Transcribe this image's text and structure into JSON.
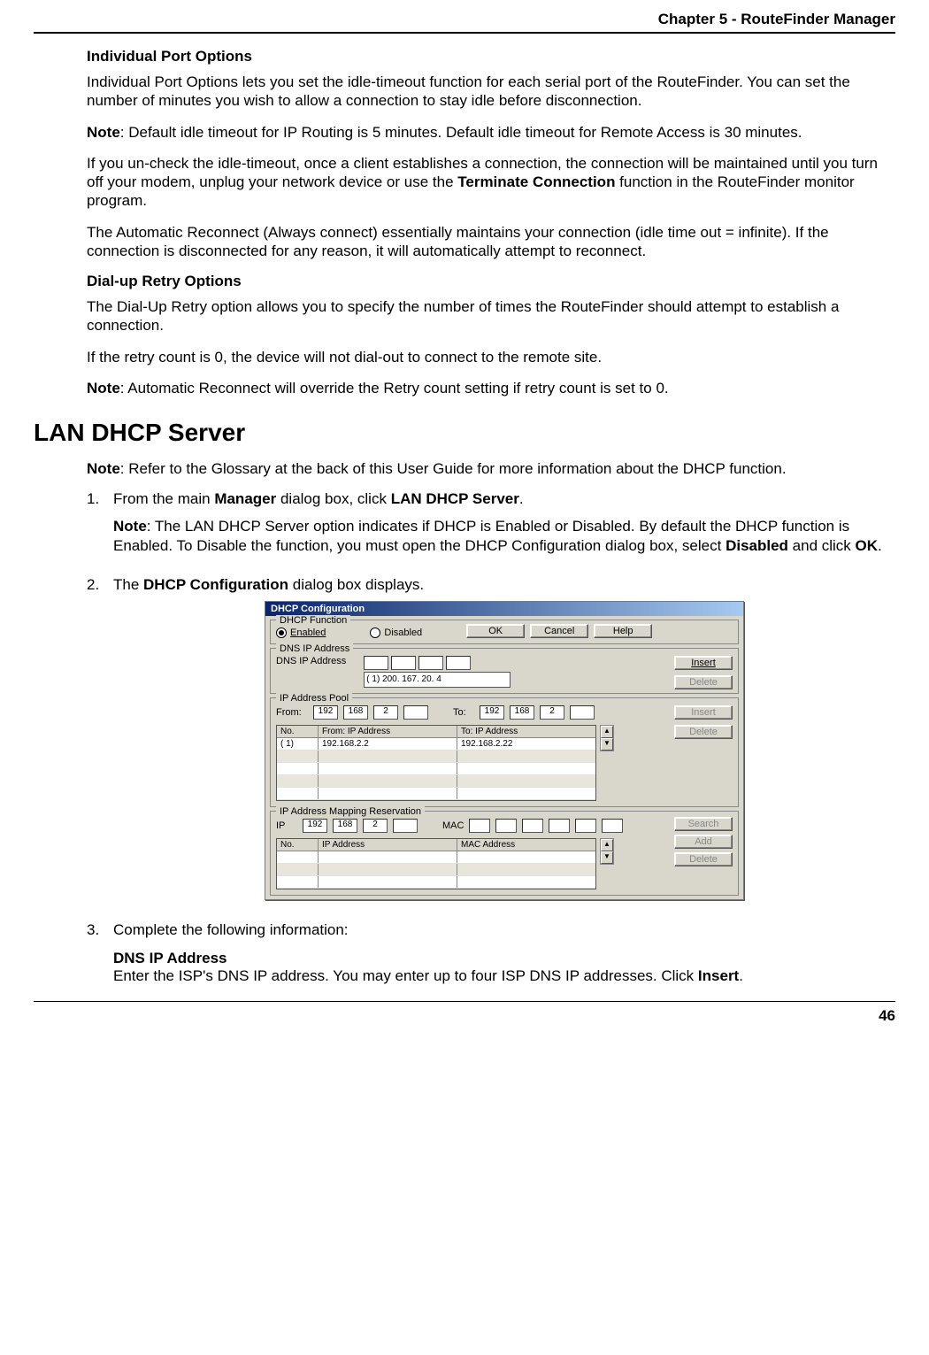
{
  "header": {
    "chapter": "Chapter 5 - RouteFinder Manager"
  },
  "section1": {
    "title": "Individual Port Options",
    "p1": "Individual Port Options lets you set the idle-timeout function for each serial port of the RouteFinder. You can set the number of minutes you wish to allow a connection to stay idle before disconnection.",
    "p2_prefix": "Note",
    "p2_rest": ": Default idle timeout for IP Routing is 5 minutes.  Default idle timeout for Remote Access is 30 minutes.",
    "p3_a": "If you un-check the  idle-timeout, once a client establishes a connection, the connection will be maintained until you turn off your modem, unplug your network device or use the ",
    "p3_bold": "Terminate Connection",
    "p3_b": " function in the RouteFinder monitor program.",
    "p4": "The Automatic Reconnect (Always connect) essentially maintains your connection (idle time out = infinite).  If the connection is disconnected for any reason, it will automatically attempt to reconnect."
  },
  "section2": {
    "title": "Dial-up Retry Options",
    "p1": "The Dial-Up Retry option allows you to specify the number of times the RouteFinder should attempt to establish a connection.",
    "p2": "If the retry count is 0, the device will not dial-out to connect to the remote site.",
    "p3_prefix": "Note",
    "p3_rest": ": Automatic Reconnect will override the Retry count setting if retry count is set to 0."
  },
  "heading": "LAN DHCP Server",
  "intro": {
    "note_prefix": "Note",
    "note_rest": ": Refer to the Glossary at the back of this User Guide for more information about the DHCP function."
  },
  "steps": {
    "s1_num": "1.",
    "s1_a": " From the main ",
    "s1_b_bold": "Manager",
    "s1_c": " dialog box, click ",
    "s1_d_bold": "LAN DHCP Server",
    "s1_e": ".",
    "s1_note_prefix": "Note",
    "s1_note_a": ": The LAN DHCP Server option indicates if DHCP is Enabled or Disabled.  By default the DHCP function is Enabled.  To Disable the function, you must open the DHCP Configuration dialog box, select ",
    "s1_note_bold": "Disabled",
    "s1_note_b": " and click ",
    "s1_note_bold2": "OK",
    "s1_note_c": ".",
    "s2_num": "2.",
    "s2_a": " The ",
    "s2_bold": "DHCP Configuration",
    "s2_b": " dialog box displays.",
    "s3_num": "3.",
    "s3_text": "Complete the following information:",
    "s3_sub_title": "DNS IP Address",
    "s3_sub_a": "Enter the ISP's DNS IP address.  You may enter up to four ISP DNS IP addresses.  Click ",
    "s3_sub_bold": "Insert",
    "s3_sub_b": "."
  },
  "dialog": {
    "title": "DHCP Configuration",
    "func_group": "DHCP Function",
    "enabled": "Enabled",
    "disabled": "Disabled",
    "ok": "OK",
    "cancel": "Cancel",
    "help": "Help",
    "dns_group": "DNS IP Address",
    "dns_label": "DNS IP Address",
    "dns_entry": "( 1) 200. 167. 20. 4",
    "insert": "Insert",
    "delete": "Delete",
    "pool_group": "IP Address Pool",
    "from": "From:",
    "to": "To:",
    "oct_192": "192",
    "oct_168": "168",
    "oct_2": "2",
    "col_no": "No.",
    "col_from": "From: IP Address",
    "col_to": "To: IP Address",
    "row1_no": "( 1)",
    "row1_from": "192.168.2.2",
    "row1_to": "192.168.2.22",
    "map_group": "IP Address Mapping Reservation",
    "ip_lbl": "IP",
    "mac_lbl": "MAC",
    "search": "Search",
    "add": "Add",
    "col_ip": "IP Address",
    "col_mac": "MAC Address"
  },
  "page_number": "46"
}
